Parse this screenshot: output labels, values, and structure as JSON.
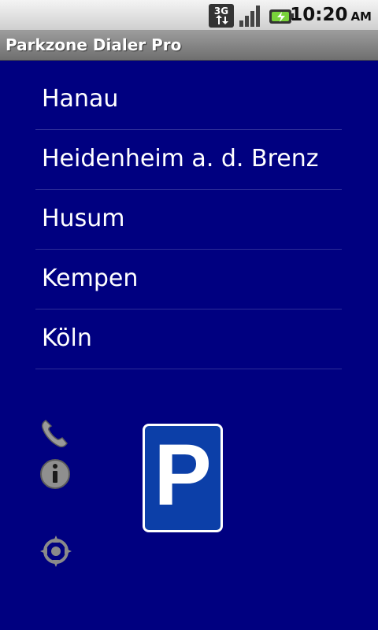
{
  "status_bar": {
    "network": "3G",
    "time": "10:20",
    "ampm": "AM"
  },
  "app": {
    "title": "Parkzone Dialer Pro"
  },
  "cities": [
    "Hanau",
    "Heidenheim a. d. Brenz",
    "Husum",
    "Kempen",
    "Köln"
  ],
  "side_icons": [
    "phone-icon",
    "info-icon",
    "location-crosshair-icon"
  ],
  "parking_sign": {
    "letter": "P"
  },
  "colors": {
    "background": "#000080",
    "title_bar": "#808080",
    "text": "#ffffff"
  }
}
